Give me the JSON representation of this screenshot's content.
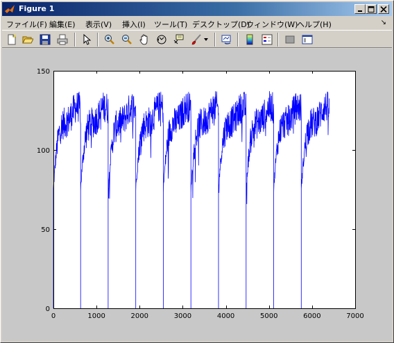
{
  "window": {
    "title": "Figure 1",
    "accent": "#0a246a"
  },
  "menubar": {
    "items": [
      {
        "label": "ファイル(F)"
      },
      {
        "label": "編集(E)"
      },
      {
        "label": "表示(V)"
      },
      {
        "label": "挿入(I)"
      },
      {
        "label": "ツール(T)"
      },
      {
        "label": "デスクトップ(D)"
      },
      {
        "label": "ウィンドウ(W)"
      },
      {
        "label": "ヘルプ(H)"
      }
    ],
    "overflow_arrow": "↘"
  },
  "toolbar": {
    "buttons": [
      "new-figure-icon",
      "open-icon",
      "save-icon",
      "print-icon",
      "select-arrow-icon",
      "zoom-in-icon",
      "zoom-out-icon",
      "pan-hand-icon",
      "rotate-3d-icon",
      "data-cursor-icon",
      "brush-icon",
      "link-plot-icon",
      "colorbar-icon",
      "legend-icon",
      "hide-plot-tools-icon",
      "show-plot-tools-icon"
    ]
  },
  "chart_data": {
    "type": "line",
    "title": "",
    "xlabel": "",
    "ylabel": "",
    "xlim": [
      0,
      7000
    ],
    "ylim": [
      0,
      150
    ],
    "xticks": [
      "0",
      "1000",
      "2000",
      "3000",
      "4000",
      "5000",
      "6000",
      "7000"
    ],
    "yticks": [
      "0",
      "50",
      "100",
      "150"
    ],
    "grid": false,
    "series": [
      {
        "color": "#0000ff",
        "x_range": [
          0,
          6400
        ],
        "drop_to_zero_at_x": [
          630,
          1270,
          1910,
          2550,
          3190,
          3830,
          4470,
          5110,
          5750
        ],
        "cycle_start_value": 75,
        "cycle_peak_mean": 125,
        "noise_amplitude": 10,
        "peak_max": 143
      }
    ]
  }
}
